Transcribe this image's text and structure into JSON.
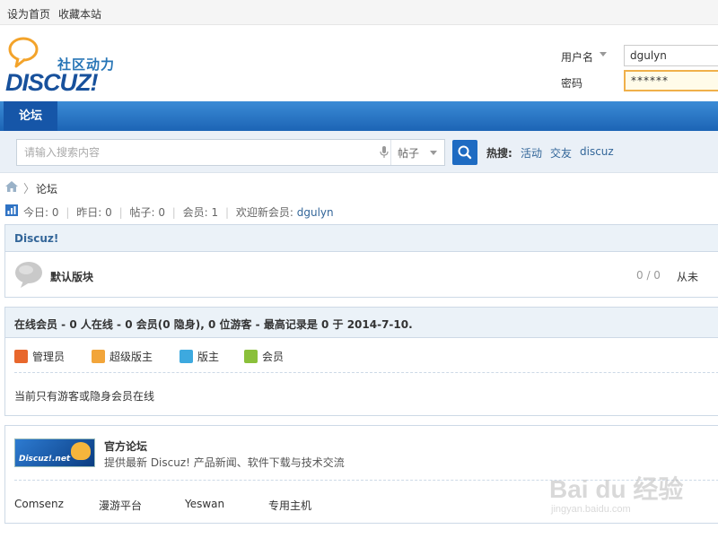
{
  "topbar": {
    "set_home": "设为首页",
    "bookmark": "收藏本站"
  },
  "header": {
    "logo_sub": "社区动力",
    "logo_main": "DISCUZ!",
    "username_label": "用户名",
    "username_value": "dgulyn",
    "password_label": "密码",
    "password_value": "******"
  },
  "nav": {
    "forum_label": "论坛"
  },
  "search": {
    "placeholder": "请输入搜索内容",
    "type_label": "帖子",
    "hot_label": "热搜:",
    "hot_items": [
      "活动",
      "交友",
      "discuz"
    ]
  },
  "breadcrumb": {
    "current": "论坛",
    "separator": "〉"
  },
  "stats": {
    "today_label": "今日:",
    "today_value": "0",
    "yesterday_label": "昨日:",
    "yesterday_value": "0",
    "posts_label": "帖子:",
    "posts_value": "0",
    "members_label": "会员:",
    "members_value": "1",
    "welcome_label": "欢迎新会员:",
    "newest_member": "dgulyn",
    "sep": "|"
  },
  "forum_block": {
    "title": "Discuz!",
    "board_name": "默认版块",
    "board_count": "0 / 0",
    "board_last": "从未"
  },
  "online": {
    "title": "在线会员 - 0 人在线 - 0 会员(0 隐身), 0 位游客 - 最高记录是 0 于 2014-7-10.",
    "legends": [
      {
        "label": "管理员",
        "color": "#e8672c"
      },
      {
        "label": "超级版主",
        "color": "#f2a53a"
      },
      {
        "label": "版主",
        "color": "#3da9df"
      },
      {
        "label": "会员",
        "color": "#8ac03a"
      }
    ],
    "note": "当前只有游客或隐身会员在线"
  },
  "links": {
    "logo_text": "Discuz!.net",
    "title": "官方论坛",
    "desc": "提供最新 Discuz! 产品新闻、软件下载与技术交流",
    "items": [
      "Comsenz",
      "漫游平台",
      "Yeswan",
      "专用主机"
    ]
  },
  "watermark": {
    "main": "Bai du 经验",
    "url": "jingyan.baidu.com"
  },
  "colors": {
    "nav_blue": "#1c64b5",
    "link_blue": "#336699",
    "search_button": "#1e6bc2",
    "focus_border": "#f0b04a"
  }
}
